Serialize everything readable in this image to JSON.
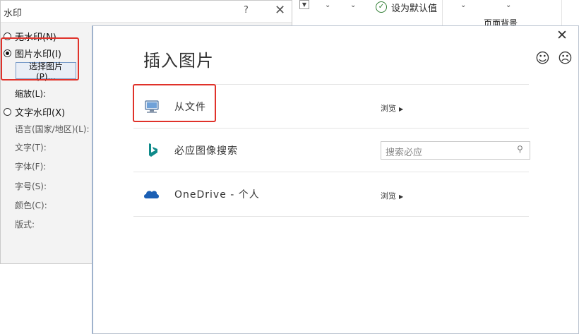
{
  "ribbon": {
    "set_default_label": "设为默认值",
    "page_background_label": "页面背景",
    "chevron": "⌄"
  },
  "watermark_dialog": {
    "title": "水印",
    "help": "?",
    "close": "✕",
    "options": [
      {
        "label": "无水印(N)",
        "selected": false
      },
      {
        "label": "图片水印(I)",
        "selected": true
      },
      {
        "label": "文字水印(X)",
        "selected": false
      }
    ],
    "choose_picture_button": "选择图片(P)...",
    "scale_label": "缩放(L):",
    "fields": [
      "语言(国家/地区)(L):",
      "文字(T):",
      "字体(F):",
      "字号(S):",
      "颜色(C):",
      "版式:"
    ]
  },
  "insert_pictures": {
    "title": "插入图片",
    "close": "✕",
    "smile": "☺",
    "frown": "☹",
    "rows": [
      {
        "label": "从文件",
        "action": "浏览",
        "icon": "computer-icon"
      },
      {
        "label": "必应图像搜索",
        "search_placeholder": "搜索必应",
        "icon": "bing-icon"
      },
      {
        "label": "OneDrive - 个人",
        "action": "浏览",
        "icon": "onedrive-icon"
      }
    ]
  },
  "colors": {
    "highlight": "#e0322a",
    "bing_teal": "#0f8a8a",
    "onedrive_blue": "#1b5fb4"
  }
}
